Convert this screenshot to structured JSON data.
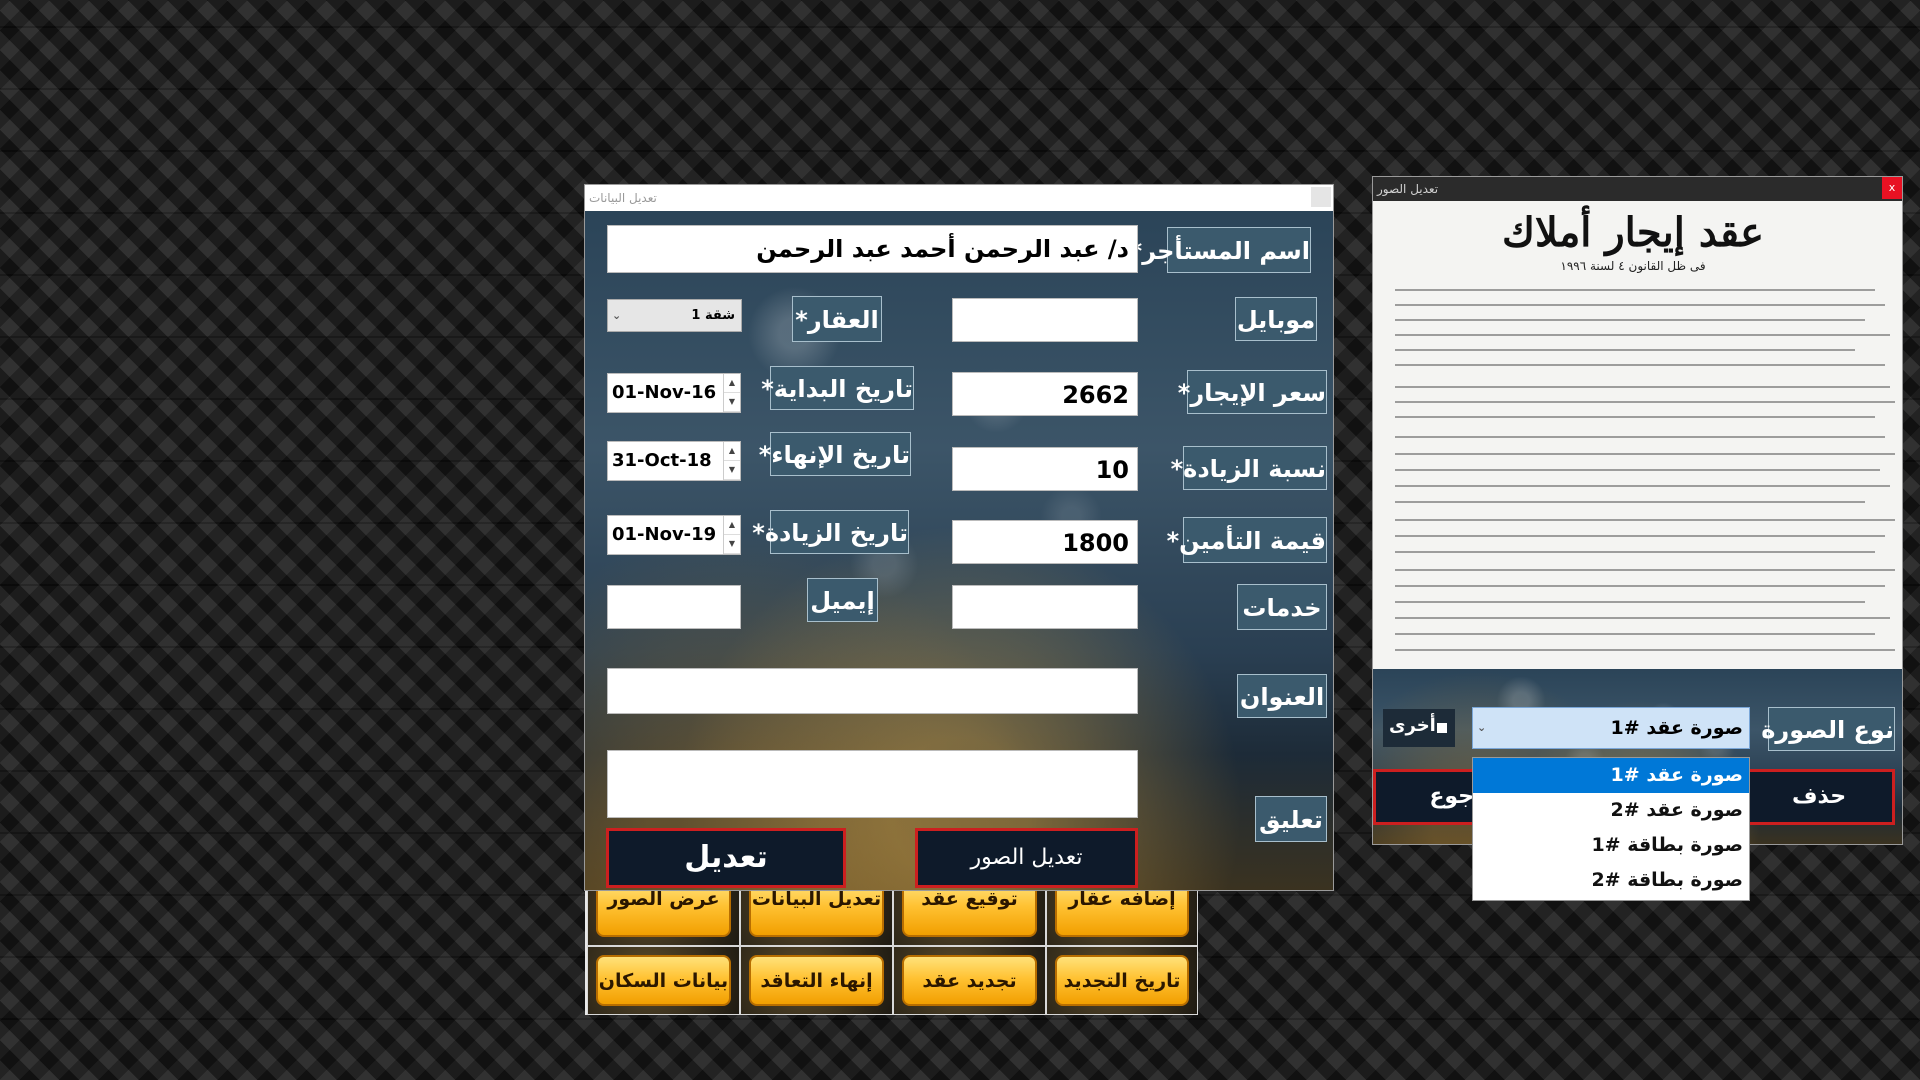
{
  "edit_window": {
    "title": "تعديل البيانات",
    "fields": {
      "tenant_name": {
        "label": "اسم المستأجر*",
        "value": "د/ عبد الرحمن أحمد عبد الرحمن"
      },
      "mobile": {
        "label": "موبايل",
        "value": ""
      },
      "property": {
        "label": "العقار*",
        "value": "شقة 1"
      },
      "rent_price": {
        "label": "سعر الإيجار*",
        "value": "2662"
      },
      "start_date": {
        "label": "تاريخ البداية*",
        "value": "01-Nov-16"
      },
      "increase_pct": {
        "label": "نسبة الزيادة*",
        "value": "10"
      },
      "end_date": {
        "label": "تاريخ الإنهاء*",
        "value": "31-Oct-18"
      },
      "insurance": {
        "label": "قيمة التأمين*",
        "value": "1800"
      },
      "increase_date": {
        "label": "تاريخ الزيادة*",
        "value": "01-Nov-19"
      },
      "services": {
        "label": "خدمات",
        "value": ""
      },
      "email": {
        "label": "إيميل",
        "value": ""
      },
      "address": {
        "label": "العنوان",
        "value": ""
      },
      "comment": {
        "label": "تعليق",
        "value": ""
      }
    },
    "buttons": {
      "edit": "تعديل",
      "edit_images": "تعديل الصور"
    }
  },
  "main_grid": {
    "row1": [
      "إضافه عقار",
      "توقيع عقد",
      "تعديل البيانات",
      "عرض الصور"
    ],
    "row2": [
      "تاريخ التجديد",
      "تجديد عقد",
      "إنهاء التعاقد",
      "بيانات السكان"
    ]
  },
  "images_window": {
    "title": "تعديل الصور",
    "close_symbol": "x",
    "document": {
      "title": "عقد إيجار أملاك",
      "subtitle": "فى ظل القانون ٤ لسنة ١٩٩٦"
    },
    "image_type_label": "نوع الصورة",
    "image_type_value": "صورة عقد #1",
    "other_checkbox_label": "أخرى",
    "delete_button": "حذف",
    "back_button_partial": "جوع",
    "dropdown_options": [
      "صورة عقد #1",
      "صورة عقد #2",
      "صورة بطاقة #1",
      "صورة بطاقة #2"
    ],
    "dropdown_selected_index": 0
  },
  "colors": {
    "label_bg": "#3b5a6d",
    "button_border": "#cc1f1f",
    "grid_button": "#ffc233",
    "selected_option": "#0078d7"
  }
}
